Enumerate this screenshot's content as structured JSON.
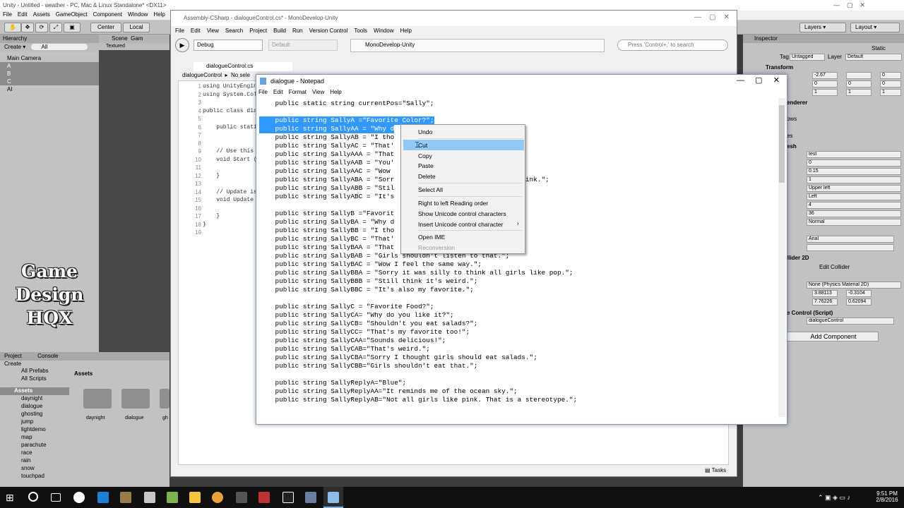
{
  "unity": {
    "title": "Unity - Untitled - weather - PC, Mac & Linux Standalone* <DX11>",
    "menu": [
      "File",
      "Edit",
      "Assets",
      "GameObject",
      "Component",
      "Window",
      "Help"
    ],
    "toolbar": {
      "center": "Center",
      "local": "Local",
      "layers": "Layers",
      "layout": "Layout"
    },
    "hierarchy": {
      "tab": "Hierarchy",
      "create": "Create",
      "search": "All",
      "items": [
        "Main Camera",
        "A",
        "B",
        "C",
        "AI"
      ]
    },
    "scene": {
      "tab": "Scene",
      "tab2": "Gam",
      "shading": "Textured"
    },
    "logo": [
      "Game",
      "Design",
      "HQX"
    ],
    "project": {
      "tab": "Project",
      "tab2": "Console",
      "create": "Create",
      "favs": [
        "All Prefabs",
        "All Scripts"
      ],
      "root": "Assets",
      "folders": [
        "daynight",
        "dialogue",
        "ghosting",
        "jump",
        "lightdemo",
        "map",
        "parachute",
        "race",
        "rain",
        "snow",
        "touchpad"
      ],
      "breadcrumb": "Assets",
      "grid": [
        "daynight",
        "dialogue",
        "gh"
      ]
    },
    "inspector": {
      "tab": "Inspector",
      "static": "Static",
      "tag_label": "Tag",
      "tag": "Untagged",
      "layer_label": "Layer",
      "layer": "Default",
      "transform": "Transform",
      "pos": [
        "-2.67",
        "",
        "0"
      ],
      "rot": [
        "0",
        "0",
        "0"
      ],
      "scale": [
        "1",
        "1",
        "1"
      ],
      "renderer": "enderer",
      "rows": "ows",
      "es": "es",
      "mesh": "esh",
      "text_fields": [
        "test",
        "0",
        "0.15",
        "1",
        "Upper left",
        "Left",
        "4",
        "36",
        "Normal",
        "",
        "Arial",
        ""
      ],
      "collider": "llider 2D",
      "edit_collider": "Edit Collider",
      "physmat": "None (Physics Material 2D)",
      "offset": [
        "3.88113",
        "-0.3104"
      ],
      "size": [
        "7.76226",
        "0.62094"
      ],
      "script": "e Control (Script)",
      "script_val": "dialogueControl",
      "add_component": "Add Component"
    }
  },
  "monodevelop": {
    "title": "Assembly-CSharp - dialogueControl.cs* - MonoDevelop-Unity",
    "menu": [
      "File",
      "Edit",
      "View",
      "Search",
      "Project",
      "Build",
      "Run",
      "Version Control",
      "Tools",
      "Window",
      "Help"
    ],
    "config": "Debug",
    "platform": "Default",
    "status": "MonoDevelop-Unity",
    "search": "Press 'Control+,' to search",
    "tab": "dialogueControl.cs",
    "crumb": "dialogueControl",
    "crumb2": "No sele",
    "code": [
      [
        "1",
        "using UnityEngin"
      ],
      [
        "2",
        "using System.Col"
      ],
      [
        "3",
        ""
      ],
      [
        "4",
        "public class dia"
      ],
      [
        "5",
        ""
      ],
      [
        "6",
        "    public stati"
      ],
      [
        "7",
        ""
      ],
      [
        "8",
        ""
      ],
      [
        "9",
        "    // Use this"
      ],
      [
        "10",
        "    void Start ("
      ],
      [
        "11",
        ""
      ],
      [
        "12",
        "    }"
      ],
      [
        "13",
        ""
      ],
      [
        "14",
        "    // Update is"
      ],
      [
        "15",
        "    void Update"
      ],
      [
        "16",
        ""
      ],
      [
        "17",
        "    }"
      ],
      [
        "18",
        "}"
      ],
      [
        "19",
        ""
      ]
    ],
    "tasks": "Tasks"
  },
  "notepad": {
    "title": "dialogue - Notepad",
    "menu": [
      "File",
      "Edit",
      "Format",
      "View",
      "Help"
    ],
    "lines": [
      [
        "    public static string currentPos=\"Sally\";",
        ""
      ],
      [
        "",
        ""
      ],
      [
        "    public string SallyA =\"Favorite Color?\";",
        "sel"
      ],
      [
        "    public string SallyAA = \"Why d",
        "sel"
      ],
      [
        "    public string SallyAB = \"I tho",
        ""
      ],
      [
        "    public string SallyAC = \"That'",
        ""
      ],
      [
        "    public string SallyAAA = \"That",
        ""
      ],
      [
        "    public string SallyAAB = \"You'",
        ""
      ],
      [
        "    public string SallyAAC = \"Wow ",
        ""
      ],
      [
        "    public string SallyABA = \"Sorr                           like pink.\";",
        ""
      ],
      [
        "    public string SallyABB = \"Stil",
        ""
      ],
      [
        "    public string SallyABC = \"It's",
        ""
      ],
      [
        "",
        ""
      ],
      [
        "    public string SallyB =\"Favorit",
        ""
      ],
      [
        "    public string SallyBA = \"Why d",
        ""
      ],
      [
        "    public string SallyBB = \"I tho                           ;",
        ""
      ],
      [
        "    public string SallyBC = \"That'",
        ""
      ],
      [
        "    public string SallyBAA = \"That",
        ""
      ],
      [
        "    public string SallyBAB = \"Girls shouldn't listen to that.\";",
        ""
      ],
      [
        "    public string SallyBAC = \"Wow I feel the same way.\";",
        ""
      ],
      [
        "    public string SallyBBA = \"Sorry it was silly to think all girls like pop.\";",
        ""
      ],
      [
        "    public string SallyBBB = \"Still think it's weird.\";",
        ""
      ],
      [
        "    public string SallyBBC = \"It's also my favorite.\";",
        ""
      ],
      [
        "",
        ""
      ],
      [
        "    public string SallyC = \"Favorite Food?\";",
        ""
      ],
      [
        "    public string SallyCA= \"Why do you like it?\";",
        ""
      ],
      [
        "    public string SallyCB= \"Shouldn't you eat salads?\";",
        ""
      ],
      [
        "    public string SallyCC= \"That's my favorite too!\";",
        ""
      ],
      [
        "    public string SallyCAA=\"Sounds delicious!\";",
        ""
      ],
      [
        "    public string SallyCAB=\"That's weird.\";",
        ""
      ],
      [
        "    public string SallyCBA=\"Sorry I thought girls should eat salads.\";",
        ""
      ],
      [
        "    public string SallyCBB=\"Girls shouldn't eat that.\";",
        ""
      ],
      [
        "",
        ""
      ],
      [
        "    public string SallyReplyA=\"Blue\";",
        ""
      ],
      [
        "    public string SallyReplyAA=\"It reminds me of the ocean sky.\";",
        ""
      ],
      [
        "    public string SallyReplyAB=\"Not all girls like pink. That is a stereotype.\";",
        ""
      ]
    ]
  },
  "context_menu": {
    "items": [
      "Undo",
      "Cut",
      "Copy",
      "Paste",
      "Delete",
      "Select All",
      "Right to left Reading order",
      "Show Unicode control characters",
      "Insert Unicode control character",
      "Open IME",
      "Reconversion"
    ]
  },
  "taskbar": {
    "time": "9:51 PM",
    "date": "2/8/2016"
  }
}
